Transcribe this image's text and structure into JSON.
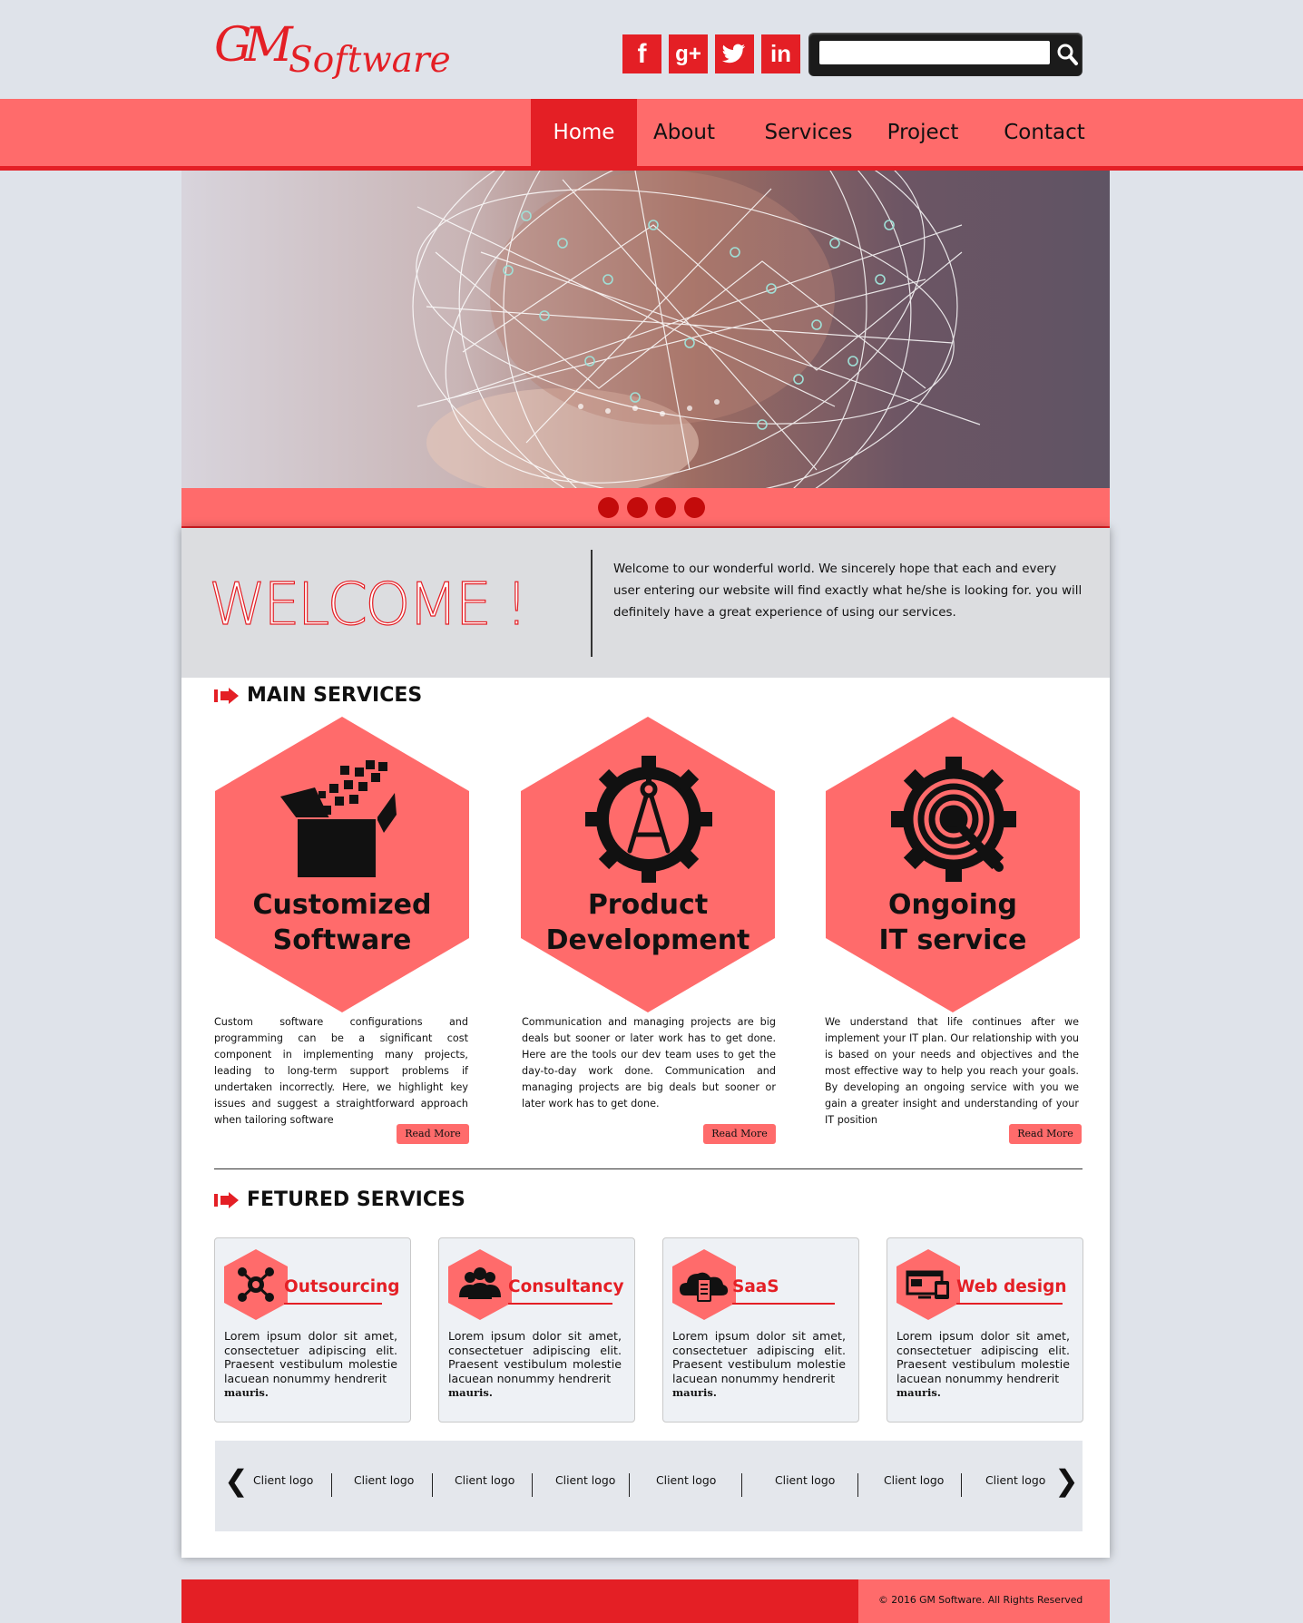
{
  "brand": {
    "logo_gm": "GM",
    "logo_software": "Software"
  },
  "social": {
    "facebook": "f",
    "google_plus": "g+",
    "twitter": "t",
    "linkedin": "in"
  },
  "search": {
    "placeholder": ""
  },
  "nav": {
    "items": [
      "Home",
      "About",
      "Services",
      "Project",
      "Contact"
    ],
    "active": "Home"
  },
  "slider": {
    "dots": 4
  },
  "welcome": {
    "title": "WELCOME !",
    "text": "Welcome to our wonderful world. We sincerely hope that each and every user entering our website will find exactly what he/she is looking for.  you will definitely have a great experience of using our  services."
  },
  "main_services": {
    "heading": "MAIN SERVICES",
    "items": [
      {
        "title_line1": "Customized",
        "title_line2": "Software",
        "text": "Custom software configurations and programming can be a significant cost component in implementing many projects, leading to long-term support problems if undertaken incorrectly. Here, we highlight key issues and suggest a straightforward approach when tailoring software",
        "button": "Read More"
      },
      {
        "title_line1": "Product",
        "title_line2": "Development",
        "text": "Communication and managing projects are big deals but sooner or later work has to get done. Here are the tools our dev team uses to get the day-to-day work done. Communication and managing projects are big deals but sooner or later work has to get done.",
        "button": "Read More"
      },
      {
        "title_line1": "Ongoing",
        "title_line2": "IT service",
        "text": "We understand that life continues after we implement your IT plan. Our relationship with you is based on your needs and objectives and the most effective way to help you reach your goals. By developing an ongoing service with you we gain a greater insight and understanding of your IT position",
        "button": "Read More"
      }
    ]
  },
  "featured_services": {
    "heading": "FETURED SERVICES",
    "items": [
      {
        "title": "Outsourcing",
        "text": "Lorem ipsum dolor sit amet, consectetuer adipiscing elit. Praesent vestibulum molestie lacuean nonummy hendrerit",
        "bold": "mauris."
      },
      {
        "title": "Consultancy",
        "text": "Lorem ipsum dolor sit amet, consectetuer adipiscing elit. Praesent vestibulum molestie lacuean nonummy hendrerit",
        "bold": "mauris."
      },
      {
        "title": "SaaS",
        "text": "Lorem ipsum dolor sit amet, consectetuer adipiscing elit. Praesent vestibulum molestie lacuean nonummy hendrerit",
        "bold": "mauris."
      },
      {
        "title": "Web design",
        "text": "Lorem ipsum dolor sit amet, consectetuer adipiscing elit. Praesent vestibulum molestie lacuean nonummy hendrerit",
        "bold": "mauris."
      }
    ]
  },
  "clients": {
    "prev": "❮",
    "next": "❯",
    "logos": [
      "Client logo",
      "Client logo",
      "Client logo",
      "Client logo",
      "Client logo",
      "Client logo",
      "Client logo",
      "Client logo"
    ]
  },
  "footer": {
    "copyright": "© 2016 GM Software. All Rights Reserved"
  },
  "colors": {
    "accent": "#e41f25",
    "salmon": "#ff6b6b",
    "page_bg": "#dfe3ea",
    "panel_bg": "#ffffff",
    "welcome_bg": "#dcdde0"
  }
}
